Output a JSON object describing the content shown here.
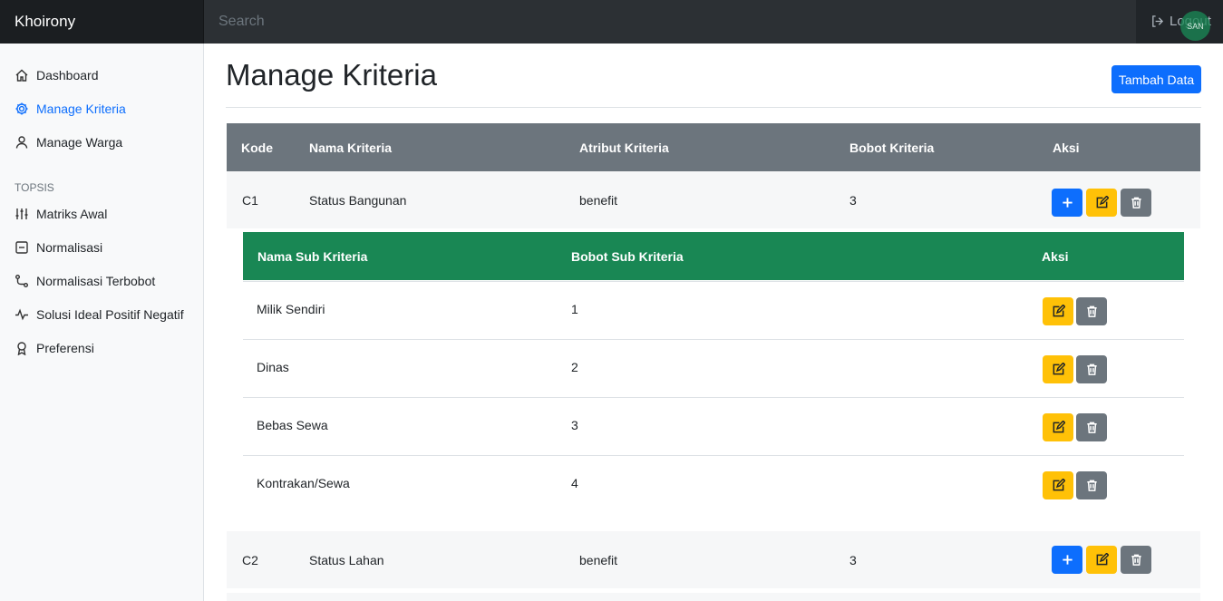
{
  "navbar": {
    "brand": "Khoirony",
    "search_placeholder": "Search",
    "logout_label": "Logout",
    "avatar_text": "SAN"
  },
  "sidebar": {
    "items": [
      {
        "label": "Dashboard",
        "icon": "house-icon"
      },
      {
        "label": "Manage Kriteria",
        "icon": "gear-icon",
        "active": true
      },
      {
        "label": "Manage Warga",
        "icon": "person-icon"
      }
    ],
    "section_heading": "TOPSIS",
    "topsis_items": [
      {
        "label": "Matriks Awal",
        "icon": "sliders-icon"
      },
      {
        "label": "Normalisasi",
        "icon": "list-box-icon"
      },
      {
        "label": "Normalisasi Terbobot",
        "icon": "path-icon"
      },
      {
        "label": "Solusi Ideal Positif Negatif",
        "icon": "pulse-icon"
      },
      {
        "label": "Preferensi",
        "icon": "award-icon"
      }
    ]
  },
  "main": {
    "title": "Manage Kriteria",
    "add_button": "Tambah Data",
    "table": {
      "headers": [
        "Kode",
        "Nama Kriteria",
        "Atribut Kriteria",
        "Bobot Kriteria",
        "Aksi"
      ],
      "rows": [
        {
          "kode": "C1",
          "nama": "Status Bangunan",
          "atribut": "benefit",
          "bobot": "3"
        },
        {
          "kode": "C2",
          "nama": "Status Lahan",
          "atribut": "benefit",
          "bobot": "3"
        }
      ]
    },
    "sub_table": {
      "headers": [
        "Nama Sub Kriteria",
        "Bobot Sub Kriteria",
        "Aksi"
      ],
      "rows": [
        {
          "nama": "Milik Sendiri",
          "bobot": "1"
        },
        {
          "nama": "Dinas",
          "bobot": "2"
        },
        {
          "nama": "Bebas Sewa",
          "bobot": "3"
        },
        {
          "nama": "Kontrakan/Sewa",
          "bobot": "4"
        }
      ]
    }
  },
  "colors": {
    "primary": "#0d6efd",
    "warning": "#ffc107",
    "secondary": "#6c757d",
    "success": "#198754",
    "dark": "#212529"
  }
}
